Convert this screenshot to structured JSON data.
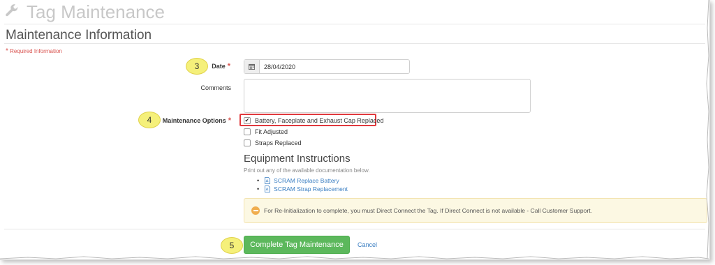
{
  "header": {
    "title": "Tag Maintenance",
    "icon": "wrench-icon"
  },
  "section": {
    "title": "Maintenance Information"
  },
  "required_note": {
    "star": "*",
    "text": "Required Information"
  },
  "callouts": {
    "date": "3",
    "options": "4",
    "complete": "5"
  },
  "form": {
    "date": {
      "label": "Date",
      "star": "*",
      "value": "28/04/2020",
      "icon": "calendar-icon"
    },
    "comments": {
      "label": "Comments",
      "value": ""
    },
    "maintenance_options": {
      "label": "Maintenance Options",
      "star": "*",
      "items": [
        {
          "label": "Battery, Faceplate and Exhaust Cap Replaced",
          "checked": true
        },
        {
          "label": "Fit Adjusted",
          "checked": false
        },
        {
          "label": "Straps Replaced",
          "checked": false
        }
      ]
    }
  },
  "equipment": {
    "title": "Equipment Instructions",
    "subtitle": "Print out any of the available documentation below.",
    "links": [
      "SCRAM Replace Battery",
      "SCRAM Strap Replacement"
    ]
  },
  "alert": {
    "text": "For Re-Initialization to complete, you must Direct Connect the Tag. If Direct Connect is not available - Call Customer Support.",
    "color": "#fcf8e3"
  },
  "actions": {
    "complete_label": "Complete Tag Maintenance",
    "cancel_label": "Cancel"
  },
  "colors": {
    "primary_button": "#5cb85c",
    "required": "#d9534f",
    "highlight": "#e0393e",
    "callout": "#f5f07a",
    "link": "#3a7ec2"
  }
}
